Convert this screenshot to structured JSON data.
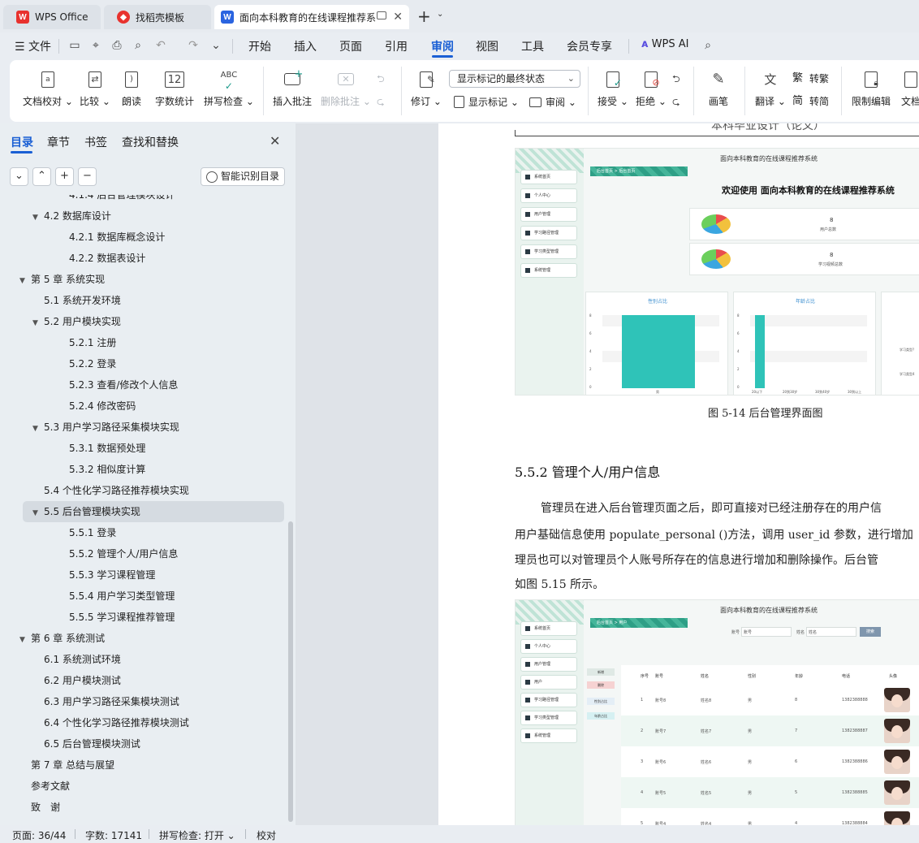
{
  "tabs": [
    {
      "label": "WPS Office",
      "icon": "wps-logo-icon",
      "color": "#e8322e"
    },
    {
      "label": "找稻壳模板",
      "icon": "docer-logo-icon",
      "color": "#e8322e"
    },
    {
      "label": "面向本科教育的在线课程推荐系",
      "icon": "word-doc-icon",
      "color": "#2a64e0"
    }
  ],
  "menu": {
    "file": "文件",
    "items": [
      "开始",
      "插入",
      "页面",
      "引用",
      "审阅",
      "视图",
      "工具",
      "会员专享"
    ],
    "active": "审阅",
    "wps_ai": "WPS AI"
  },
  "ribbon": {
    "doc_check": "文档校对",
    "compare": "比较",
    "read_aloud": "朗读",
    "word_count": "字数统计",
    "spell_check": "拼写检查",
    "insert_comment": "插入批注",
    "delete_comment": "删除批注",
    "track_changes": "修订",
    "markup_select": "显示标记的最终状态",
    "show_markup": "显示标记",
    "review_pane": "审阅",
    "accept": "接受",
    "reject": "拒绝",
    "pen": "画笔",
    "translate": "翻译",
    "to_traditional": "转繁",
    "to_simplified": "转简",
    "restrict_edit": "限制编辑",
    "doc_more": "文档"
  },
  "nav": {
    "tabs": [
      "目录",
      "章节",
      "书签",
      "查找和替换"
    ],
    "active_tab": "目录",
    "ai_toc": "智能识别目录",
    "toc": [
      {
        "text": "4.1.4 后台管理模块设计",
        "level": 3,
        "arrow": false
      },
      {
        "text": "4.2 数据库设计",
        "level": 2,
        "arrow": true
      },
      {
        "text": "4.2.1 数据库概念设计",
        "level": 3,
        "arrow": false
      },
      {
        "text": "4.2.2 数据表设计",
        "level": 3,
        "arrow": false
      },
      {
        "text": "第 5 章 系统实现",
        "level": 1,
        "arrow": true
      },
      {
        "text": "5.1 系统开发环境",
        "level": 2,
        "arrow": false
      },
      {
        "text": "5.2 用户模块实现",
        "level": 2,
        "arrow": true
      },
      {
        "text": "5.2.1 注册",
        "level": 3,
        "arrow": false
      },
      {
        "text": "5.2.2 登录",
        "level": 3,
        "arrow": false
      },
      {
        "text": "5.2.3 查看/修改个人信息",
        "level": 3,
        "arrow": false
      },
      {
        "text": "5.2.4 修改密码",
        "level": 3,
        "arrow": false
      },
      {
        "text": "5.3 用户学习路径采集模块实现",
        "level": 2,
        "arrow": true
      },
      {
        "text": "5.3.1 数据预处理",
        "level": 3,
        "arrow": false
      },
      {
        "text": "5.3.2 相似度计算",
        "level": 3,
        "arrow": false
      },
      {
        "text": "5.4 个性化学习路径推荐模块实现",
        "level": 2,
        "arrow": false
      },
      {
        "text": "5.5 后台管理模块实现",
        "level": 2,
        "arrow": true,
        "selected": true
      },
      {
        "text": "5.5.1 登录",
        "level": 3,
        "arrow": false
      },
      {
        "text": "5.5.2 管理个人/用户信息",
        "level": 3,
        "arrow": false
      },
      {
        "text": "5.5.3 学习课程管理",
        "level": 3,
        "arrow": false
      },
      {
        "text": "5.5.4 用户学习类型管理",
        "level": 3,
        "arrow": false
      },
      {
        "text": "5.5.5 学习课程推荐管理",
        "level": 3,
        "arrow": false
      },
      {
        "text": "第 6 章 系统测试",
        "level": 1,
        "arrow": true
      },
      {
        "text": "6.1 系统测试环境",
        "level": 2,
        "arrow": false
      },
      {
        "text": "6.2 用户模块测试",
        "level": 2,
        "arrow": false
      },
      {
        "text": "6.3 用户学习路径采集模块测试",
        "level": 2,
        "arrow": false
      },
      {
        "text": "6.4 个性化学习路径推荐模块测试",
        "level": 2,
        "arrow": false
      },
      {
        "text": "6.5 后台管理模块测试",
        "level": 2,
        "arrow": false
      },
      {
        "text": "第 7 章 总结与展望",
        "level": 1,
        "arrow": false
      },
      {
        "text": "参考文献",
        "level": 1,
        "arrow": false
      },
      {
        "text": "致　谢",
        "level": 1,
        "arrow": false
      }
    ]
  },
  "document": {
    "header": "本科毕业设计（论文）",
    "shot1": {
      "system_title": "面向本科教育的在线课程推荐系统",
      "crumb": "后台首页 > 后台首页",
      "welcome": "欢迎使用 面向本科教育的在线课程推荐系统",
      "menu": [
        "系统首页",
        "个人中心",
        "用户管理",
        "学习路径管理",
        "学习类型管理",
        "系统管理"
      ],
      "stat1": {
        "value": "8",
        "label": "用户总数"
      },
      "stat2": {
        "value": "8",
        "label": "学习视频总数"
      },
      "chart1_title": "性别占比",
      "chart2_title": "年龄占比",
      "chart1_x": "男",
      "chart2_x": [
        "20以下",
        "20到30岁",
        "30到40岁",
        "30到以上"
      ],
      "y_ticks": [
        "8",
        "6",
        "4",
        "2",
        "0"
      ],
      "side_labels": [
        "学习类型?",
        "学习类型4"
      ]
    },
    "caption1": "图 5-14 后台管理界面图",
    "section_heading": "5.5.2  管理个人/用户信息",
    "paragraph_lines": [
      "管理员在进入后台管理页面之后，即可直接对已经注册存在的用户信",
      "用户基础信息使用 populate_personal ()方法，调用 user_id 参数，进行增加",
      "理员也可以对管理员个人账号所存在的信息进行增加和删除操作。后台管",
      "如图 5.15 所示。"
    ],
    "shot2": {
      "system_title": "面向本科教育的在线课程推荐系统",
      "crumb": "后台首页 > 用户",
      "search_label1": "账号",
      "search_label2": "姓名",
      "search_ph1": "账号",
      "search_ph2": "姓名",
      "search_btn": "搜索",
      "menu": [
        "系统首页",
        "个人中心",
        "用户管理",
        "用户",
        "学习路径管理",
        "学习类型管理",
        "系统管理"
      ],
      "tags": [
        "新增",
        "删除",
        "性别占比",
        "年龄占比"
      ],
      "headers": [
        "序号",
        "账号",
        "姓名",
        "性别",
        "年龄",
        "电话",
        "头像"
      ],
      "rows": [
        [
          "1",
          "账号8",
          "姓名8",
          "男",
          "8",
          "1382388888"
        ],
        [
          "2",
          "账号7",
          "姓名7",
          "男",
          "7",
          "1382388887"
        ],
        [
          "3",
          "账号6",
          "姓名6",
          "男",
          "6",
          "1382388886"
        ],
        [
          "4",
          "账号5",
          "姓名5",
          "男",
          "5",
          "1382388885"
        ],
        [
          "5",
          "账号4",
          "姓名4",
          "男",
          "4",
          "1382388884"
        ]
      ]
    }
  },
  "status": {
    "page": "页面: 36/44",
    "words": "字数: 17141",
    "spell": "拼写检查: 打开",
    "proof": "校对"
  }
}
